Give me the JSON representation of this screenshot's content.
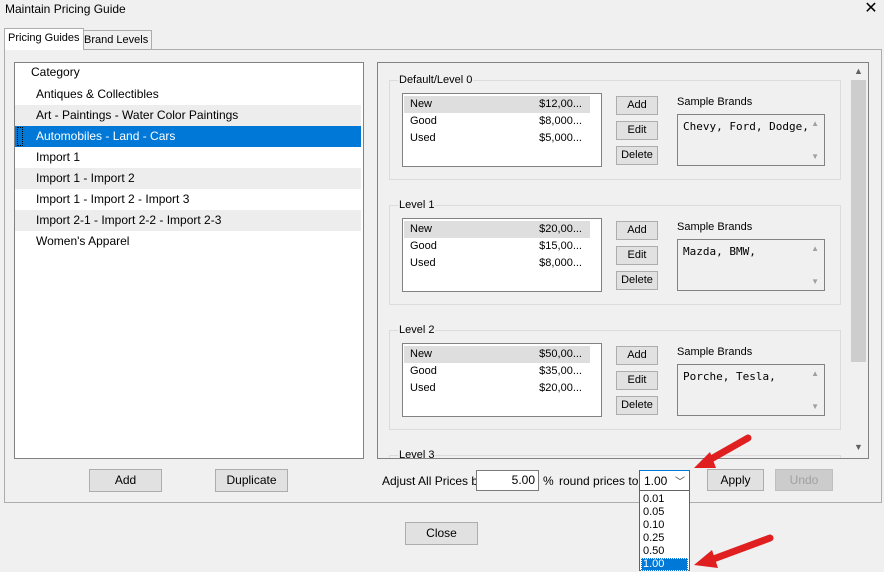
{
  "window": {
    "title": "Maintain Pricing Guide",
    "close_glyph": "✕"
  },
  "tabs": [
    {
      "label": "Pricing Guides",
      "active": true
    },
    {
      "label": "Brand Levels",
      "active": false
    }
  ],
  "category_list": {
    "header": "Category",
    "items": [
      {
        "label": "Antiques & Collectibles"
      },
      {
        "label": "Art - Paintings - Water Color Paintings"
      },
      {
        "label": "Automobiles - Land - Cars",
        "selected": true
      },
      {
        "label": "Import 1"
      },
      {
        "label": "Import 1 - Import 2"
      },
      {
        "label": "Import 1 - Import 2 - Import 3"
      },
      {
        "label": "Import 2-1 - Import 2-2 - Import 2-3"
      },
      {
        "label": "Women's Apparel"
      }
    ]
  },
  "left_buttons": {
    "add": "Add",
    "duplicate": "Duplicate"
  },
  "levels": [
    {
      "label": "Default/Level 0",
      "prices": [
        {
          "name": "New",
          "value": "$12,00..."
        },
        {
          "name": "Good",
          "value": "$8,000..."
        },
        {
          "name": "Used",
          "value": "$5,000..."
        }
      ],
      "sample_brands_label": "Sample Brands",
      "sample_brands": "Chevy, Ford, Dodge,"
    },
    {
      "label": "Level 1",
      "prices": [
        {
          "name": "New",
          "value": "$20,00..."
        },
        {
          "name": "Good",
          "value": "$15,00..."
        },
        {
          "name": "Used",
          "value": "$8,000..."
        }
      ],
      "sample_brands_label": "Sample Brands",
      "sample_brands": "Mazda, BMW,"
    },
    {
      "label": "Level 2",
      "prices": [
        {
          "name": "New",
          "value": "$50,00..."
        },
        {
          "name": "Good",
          "value": "$35,00..."
        },
        {
          "name": "Used",
          "value": "$20,00..."
        }
      ],
      "sample_brands_label": "Sample Brands",
      "sample_brands": "Porche, Tesla,"
    },
    {
      "label": "Level 3"
    }
  ],
  "level_buttons": {
    "add": "Add",
    "edit": "Edit",
    "delete": "Delete"
  },
  "adjust": {
    "label": "Adjust All Prices by",
    "value": "5.00",
    "percent": "%",
    "round_label": "round prices to",
    "round_value": "1.00",
    "round_options": [
      "0.01",
      "0.05",
      "0.10",
      "0.25",
      "0.50",
      "1.00"
    ],
    "apply": "Apply",
    "undo": "Undo"
  },
  "footer": {
    "close": "Close"
  },
  "colors": {
    "selection": "#0078d7",
    "annotation_arrow": "#e02020"
  }
}
